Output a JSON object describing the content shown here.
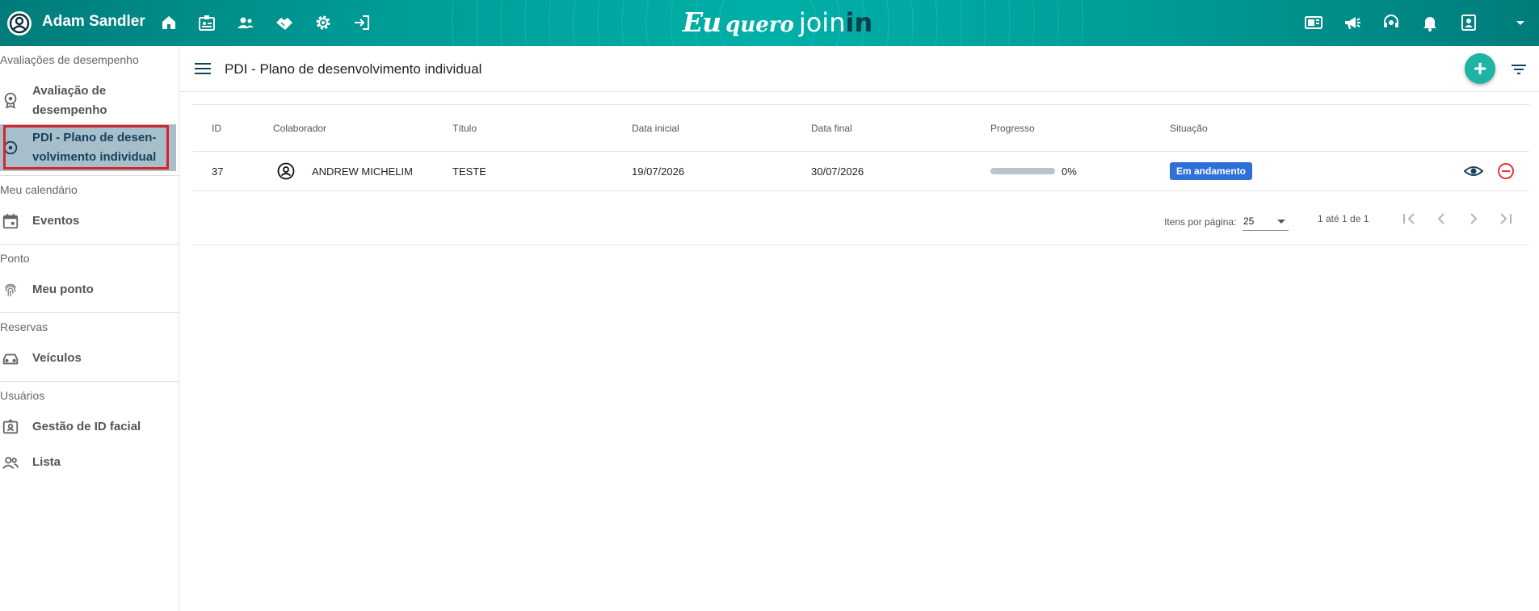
{
  "header": {
    "user_name": "Adam Sandler",
    "logo": {
      "part1": "Eu",
      "part2": "quero",
      "part3": "join",
      "part4": "in"
    },
    "left_icons": [
      "home-icon",
      "badge-icon",
      "people-icon",
      "handshake-icon",
      "gear-icon",
      "login-icon"
    ],
    "right_icons": [
      "newspaper-icon",
      "megaphone-icon",
      "support-agent-icon",
      "bell-icon",
      "contact-card-icon",
      "dropdown-caret-icon"
    ]
  },
  "sidebar": {
    "sections": [
      {
        "title": "Avaliações de desempenho",
        "items": [
          {
            "label_line1": "Avaliação de",
            "label_line2": "desempenho",
            "icon": "award-icon"
          },
          {
            "label_line1": "PDI - Plano de desen-",
            "label_line2": "volvimento individual",
            "icon": "target-icon",
            "active": true
          }
        ]
      },
      {
        "title": "Meu calendário",
        "items": [
          {
            "label": "Eventos",
            "icon": "calendar-icon"
          }
        ]
      },
      {
        "title": "Ponto",
        "items": [
          {
            "label": "Meu ponto",
            "icon": "fingerprint-icon"
          }
        ]
      },
      {
        "title": "Reservas",
        "items": [
          {
            "label": "Veículos",
            "icon": "car-icon"
          }
        ]
      },
      {
        "title": "Usuários",
        "items": [
          {
            "label": "Gestão de ID facial",
            "icon": "face-id-icon"
          },
          {
            "label": "Lista",
            "icon": "group-icon"
          }
        ]
      }
    ]
  },
  "main": {
    "title": "PDI - Plano de desenvolvimento individual",
    "table": {
      "columns": [
        "ID",
        "Colaborador",
        "Título",
        "Data inicial",
        "Data final",
        "Progresso",
        "Situação"
      ],
      "rows": [
        {
          "id": "37",
          "colaborador": "ANDREW MICHELIM",
          "titulo": "TESTE",
          "data_inicial": "19/07/2026",
          "data_final": "30/07/2026",
          "progresso": 0,
          "progresso_label": "0%",
          "situacao": "Em andamento"
        }
      ]
    },
    "pagination": {
      "items_label": "Itens por página:",
      "page_size": "25",
      "range": "1 até 1 de 1"
    }
  },
  "colors": {
    "accent": "#1fb3a4",
    "header": "#00a6a0",
    "status_badge": "#2f6fd8",
    "remove": "#e53935",
    "active_item": "#a7bfcb"
  }
}
